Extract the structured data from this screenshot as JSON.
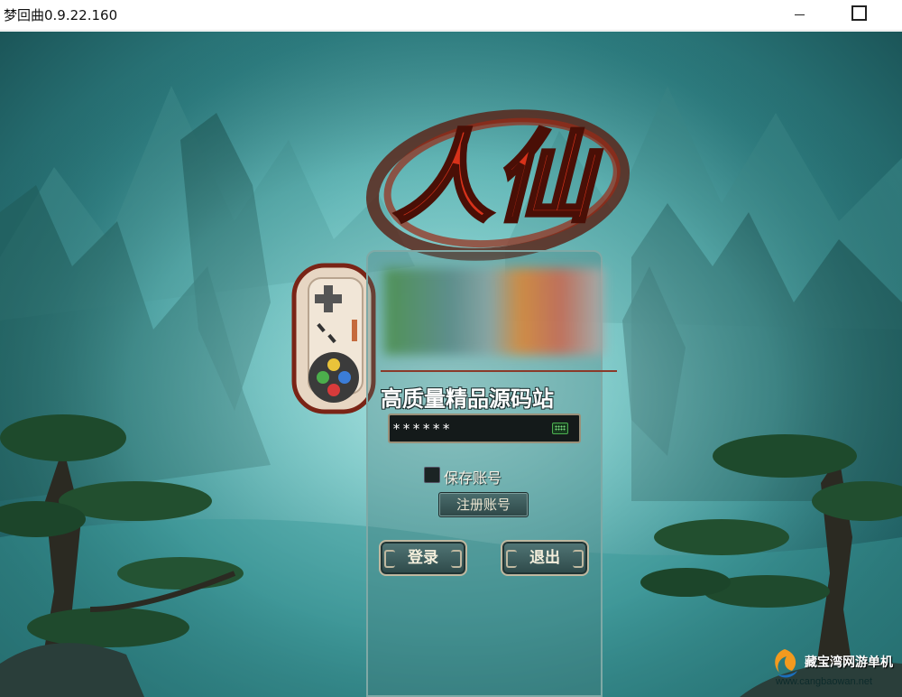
{
  "window": {
    "title": "梦回曲0.9.22.160"
  },
  "login_panel": {
    "site_name": "高质量精品源码站",
    "password_value": "******",
    "save_account_label": "保存账号",
    "save_account_checked": false,
    "register_label": "注册账号",
    "login_label": "登录",
    "exit_label": "退出"
  },
  "logo": {
    "text": "人仙"
  },
  "watermark": {
    "cn": "藏宝湾网游单机",
    "url": "www.cangbaowan.net"
  },
  "colors": {
    "logo_red": "#c8301c",
    "panel_border": "#7fa9a6",
    "button_face": "#3d5e5e"
  }
}
